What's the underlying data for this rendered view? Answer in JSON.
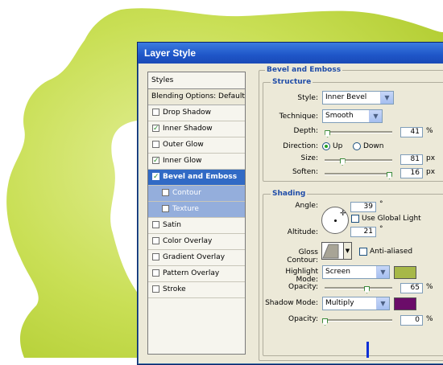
{
  "window": {
    "title": "Layer Style"
  },
  "colors": {
    "blob": "#c5dd4a",
    "highlight_swatch": "#a7b848",
    "shadow_swatch": "#6b0c69",
    "selection": "#316ac5",
    "legend": "#1f4ca8"
  },
  "styles_panel": {
    "header": "Styles",
    "blending": "Blending Options: Default",
    "items": [
      {
        "label": "Drop Shadow",
        "checked": false
      },
      {
        "label": "Inner Shadow",
        "checked": true
      },
      {
        "label": "Outer Glow",
        "checked": false
      },
      {
        "label": "Inner Glow",
        "checked": true
      },
      {
        "label": "Bevel and Emboss",
        "checked": true,
        "selected": true
      },
      {
        "label": "Contour",
        "checked": false,
        "sub": true
      },
      {
        "label": "Texture",
        "checked": false,
        "sub": true
      },
      {
        "label": "Satin",
        "checked": false
      },
      {
        "label": "Color Overlay",
        "checked": false
      },
      {
        "label": "Gradient Overlay",
        "checked": false
      },
      {
        "label": "Pattern Overlay",
        "checked": false
      },
      {
        "label": "Stroke",
        "checked": false
      }
    ]
  },
  "bevel": {
    "title": "Bevel and Emboss",
    "structure": {
      "title": "Structure",
      "style_label": "Style:",
      "style_value": "Inner Bevel",
      "technique_label": "Technique:",
      "technique_value": "Smooth",
      "depth_label": "Depth:",
      "depth_value": "41",
      "depth_unit": "%",
      "depth_level": 0.04,
      "direction_label": "Direction:",
      "dir_up": "Up",
      "dir_down": "Down",
      "direction_selected": "Up",
      "size_label": "Size:",
      "size_value": "81",
      "size_unit": "px",
      "size_level": 0.27,
      "soften_label": "Soften:",
      "soften_value": "16",
      "soften_unit": "px",
      "soften_level": 1.0
    },
    "shading": {
      "title": "Shading",
      "angle_label": "Angle:",
      "angle_value": "39",
      "angle_unit": "°",
      "global_light_label": "Use Global Light",
      "global_light_checked": false,
      "altitude_label": "Altitude:",
      "altitude_value": "21",
      "altitude_unit": "°",
      "gloss_label": "Gloss Contour:",
      "anti_aliased_label": "Anti-aliased",
      "anti_aliased_checked": false,
      "highlight_mode_label": "Highlight Mode:",
      "highlight_mode_value": "Screen",
      "highlight_opacity_label": "Opacity:",
      "highlight_opacity_value": "65",
      "highlight_opacity_unit": "%",
      "highlight_opacity_level": 0.65,
      "shadow_mode_label": "Shadow Mode:",
      "shadow_mode_value": "Multiply",
      "shadow_opacity_label": "Opacity:",
      "shadow_opacity_value": "0",
      "shadow_opacity_unit": "%",
      "shadow_opacity_level": 0.0
    }
  }
}
